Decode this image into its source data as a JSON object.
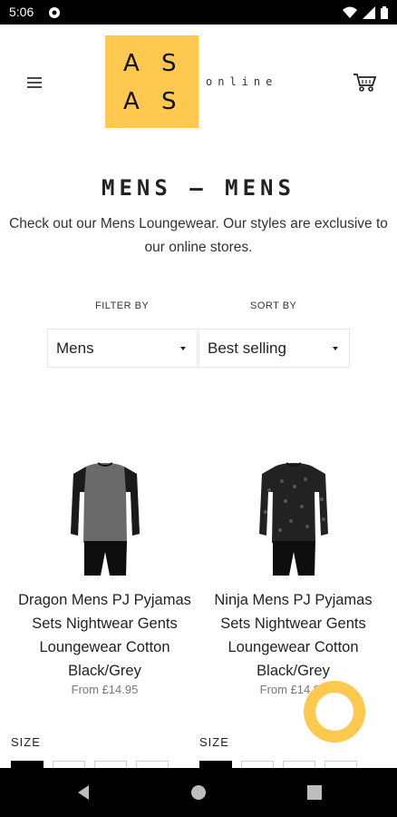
{
  "status_bar": {
    "time": "5:06"
  },
  "header": {
    "logo": {
      "letters": [
        "A",
        "S",
        "A",
        "S"
      ],
      "suffix": "online",
      "color": "#ffc94f"
    },
    "menu_icon": "hamburger-icon",
    "cart_icon": "cart-icon"
  },
  "collection": {
    "title": "MENS — MENS",
    "description": "Check out our Mens Loungewear. Our styles are exclusive to our online stores."
  },
  "filters": {
    "filter_label": "FILTER BY",
    "filter_value": "Mens",
    "sort_label": "SORT BY",
    "sort_value": "Best selling"
  },
  "products": [
    {
      "title": "Dragon Mens PJ Pyjamas Sets Nightwear Gents Loungewear Cotton Black/Grey",
      "price": "From £14.95",
      "size_label": "SIZE"
    },
    {
      "title": "Ninja Mens PJ Pyjamas Sets Nightwear Gents Loungewear Cotton Black/Grey",
      "price": "From £14.95",
      "size_label": "SIZE"
    }
  ],
  "accent_color": "#ffc94f"
}
